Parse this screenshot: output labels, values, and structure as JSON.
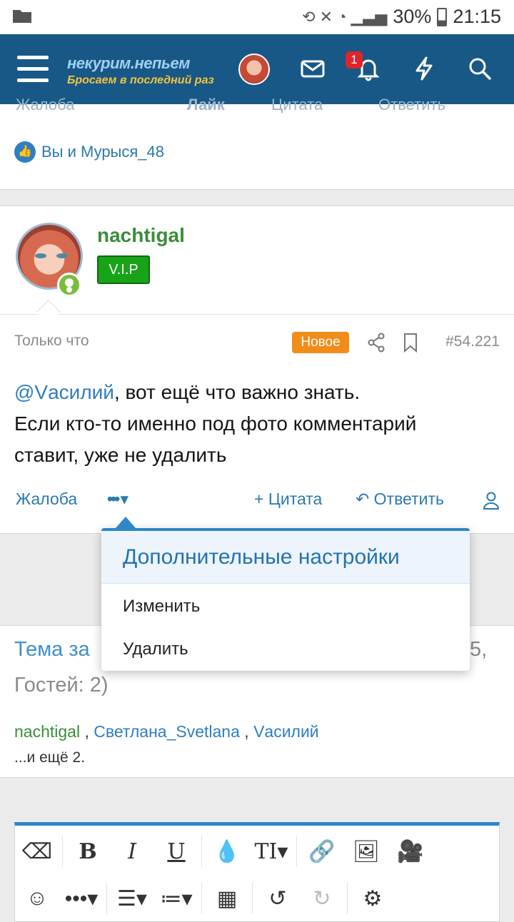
{
  "statusbar": {
    "battery": "30%",
    "time": "21:15"
  },
  "app": {
    "logo_line1": "некурим.непьем",
    "logo_line2": "Бросаем в последний раз",
    "notification_count": "1"
  },
  "prev_post": {
    "actions": [
      "Жалоба",
      "Лайк",
      "Цитата",
      "Ответить"
    ],
    "likes_text": "Вы и Мурыся_48"
  },
  "post": {
    "author": "nachtigal",
    "badge": "V.I.P",
    "time": "Только что",
    "new_label": "Новое",
    "number": "#54.221",
    "mention": "@Vасилий",
    "text_line1_rest": ", вот ещё что важно знать.",
    "text_line2": "Если кто-то именно под фото комментарий",
    "text_line3": "ставит, уже не удалить",
    "report": "Жалоба",
    "more": "•••",
    "quote": "Цитата",
    "reply": "Ответить"
  },
  "menu": {
    "title": "Дополнительные настройки",
    "items": [
      "Изменить",
      "Удалить"
    ]
  },
  "online": {
    "title_visible": "Тема за",
    "title_tail": "5,",
    "guests": "Гостей: 2)",
    "users": [
      "nachtigal",
      "Светлана_Svetlana",
      "Vасилий"
    ],
    "more": "...и ещё 2."
  }
}
